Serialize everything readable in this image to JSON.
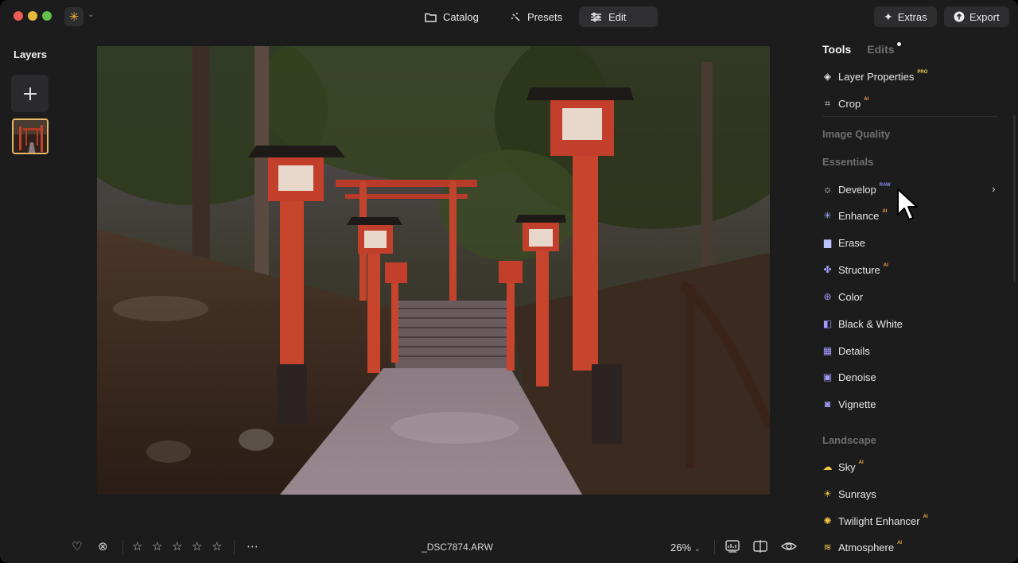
{
  "titlebar": {
    "tabs": [
      {
        "label": "Catalog",
        "icon": "folder-icon"
      },
      {
        "label": "Presets",
        "icon": "sparkle-dots-icon"
      },
      {
        "label": "Edit",
        "icon": "sliders-icon",
        "active": true
      }
    ],
    "extras_label": "Extras",
    "export_label": "Export"
  },
  "layers": {
    "title": "Layers"
  },
  "bottom": {
    "filename": "_DSC7874.ARW",
    "zoom": "26%",
    "rating": 0,
    "max_rating": 5
  },
  "panel": {
    "tab_tools": "Tools",
    "tab_edits": "Edits",
    "items": [
      {
        "label": "Layer Properties",
        "badge": "PRO",
        "icon": "layers-icon"
      },
      {
        "label": "Crop",
        "badge": "AI",
        "icon": "crop-icon"
      }
    ],
    "sections": {
      "image_quality": "Image Quality",
      "essentials": "Essentials",
      "landscape": "Landscape"
    },
    "essentials": [
      {
        "label": "Develop",
        "badge": "RAW",
        "icon": "sun-icon"
      },
      {
        "label": "Enhance",
        "badge": "AI",
        "icon": "sparkle-icon"
      },
      {
        "label": "Erase",
        "badge": "",
        "icon": "eraser-icon"
      },
      {
        "label": "Structure",
        "badge": "AI",
        "icon": "structure-icon"
      },
      {
        "label": "Color",
        "badge": "",
        "icon": "color-circles-icon"
      },
      {
        "label": "Black & White",
        "badge": "",
        "icon": "black-white-icon"
      },
      {
        "label": "Details",
        "badge": "",
        "icon": "details-grid-icon"
      },
      {
        "label": "Denoise",
        "badge": "",
        "icon": "denoise-icon"
      },
      {
        "label": "Vignette",
        "badge": "",
        "icon": "vignette-icon"
      }
    ],
    "landscape": [
      {
        "label": "Sky",
        "badge": "AI",
        "icon": "cloud-icon"
      },
      {
        "label": "Sunrays",
        "badge": "",
        "icon": "sunrays-icon"
      },
      {
        "label": "Twilight Enhancer",
        "badge": "AI",
        "icon": "twilight-icon"
      },
      {
        "label": "Atmosphere",
        "badge": "AI",
        "icon": "atmosphere-icon"
      }
    ]
  },
  "colors": {
    "accent_yellow": "#f1c84a",
    "badge_ai": "#f1a64a",
    "badge_raw": "#8f8cf5",
    "selection_border": "#e9b865"
  }
}
